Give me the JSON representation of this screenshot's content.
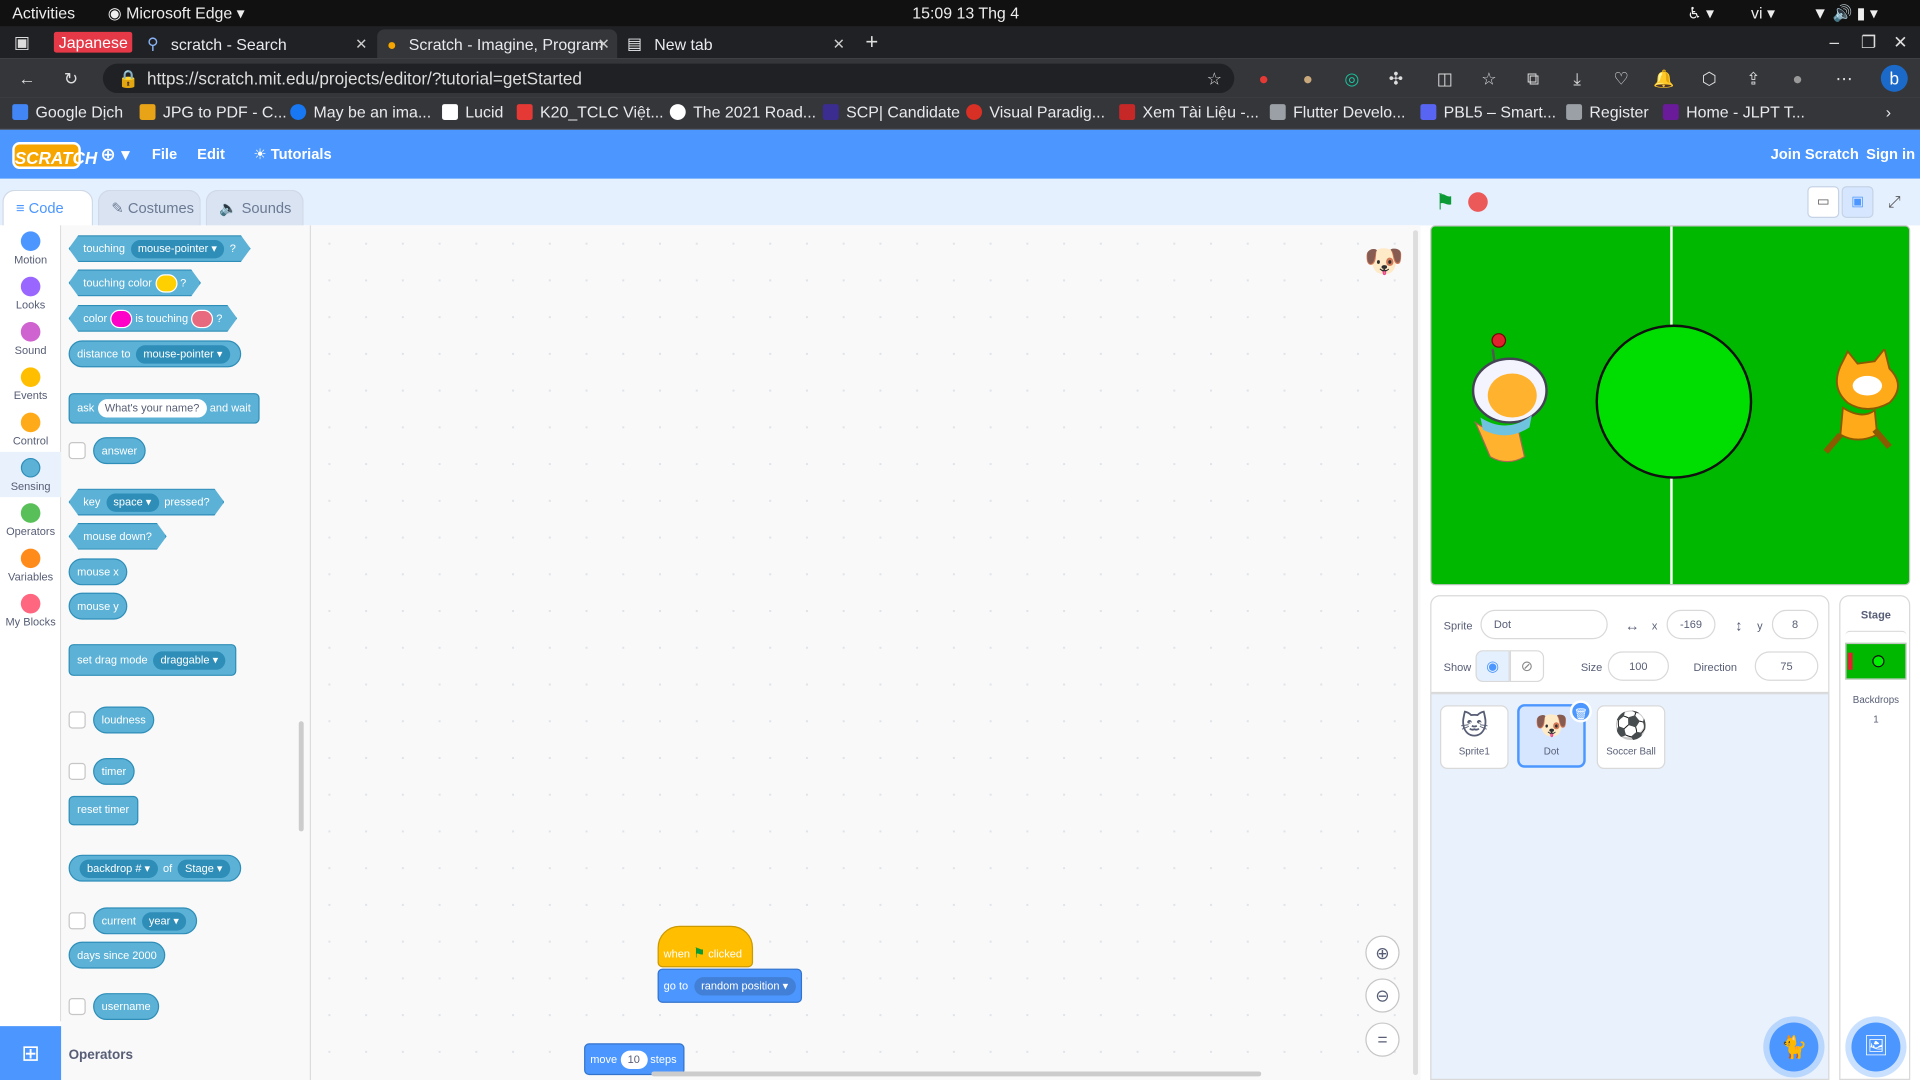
{
  "os": {
    "activities": "Activities",
    "app": "Microsoft Edge",
    "clock": "15:09  13 Thg 4",
    "lang": "vi"
  },
  "browser": {
    "ime_label": "Japanese",
    "tabs": [
      {
        "title": "scratch - Search"
      },
      {
        "title": "Scratch - Imagine, Program"
      },
      {
        "title": "New tab"
      }
    ],
    "url": "https://scratch.mit.edu/projects/editor/?tutorial=getStarted",
    "bookmarks": [
      {
        "label": "Google Dịch",
        "color": "#4285f4"
      },
      {
        "label": "JPG to PDF - C...",
        "color": "#e8a317"
      },
      {
        "label": "May be an ima...",
        "color": "#1877f2"
      },
      {
        "label": "Lucid",
        "color": "#ffffff"
      },
      {
        "label": "K20_TCLC Việt...",
        "color": "#e53935"
      },
      {
        "label": "The 2021 Road...",
        "color": "#ffffff"
      },
      {
        "label": "SCP| Candidate",
        "color": "#3b2c8f"
      },
      {
        "label": "Visual Paradig...",
        "color": "#d93025"
      },
      {
        "label": "Xem Tài Liệu -...",
        "color": "#c62828"
      },
      {
        "label": "Flutter Develo...",
        "color": "#9aa0a6"
      },
      {
        "label": "PBL5 – Smart...",
        "color": "#5865f2"
      },
      {
        "label": "Register",
        "color": "#9aa0a6"
      },
      {
        "label": "Home - JLPT T...",
        "color": "#6a1b9a"
      }
    ]
  },
  "scratch": {
    "menu": {
      "logo": "SCRATCH",
      "file": "File",
      "edit": "Edit",
      "tutorials": "Tutorials",
      "join": "Join Scratch",
      "signin": "Sign in"
    },
    "editor_tabs": {
      "code": "Code",
      "costumes": "Costumes",
      "sounds": "Sounds"
    },
    "categories": [
      {
        "label": "Motion",
        "color": "#4c97ff"
      },
      {
        "label": "Looks",
        "color": "#9966ff"
      },
      {
        "label": "Sound",
        "color": "#cf63cf"
      },
      {
        "label": "Events",
        "color": "#ffbf00"
      },
      {
        "label": "Control",
        "color": "#ffab19"
      },
      {
        "label": "Sensing",
        "color": "#5cb1d6"
      },
      {
        "label": "Operators",
        "color": "#59c059"
      },
      {
        "label": "Variables",
        "color": "#ff8c1a"
      },
      {
        "label": "My Blocks",
        "color": "#ff6680"
      }
    ],
    "palette": {
      "touching": "touching",
      "mouse_pointer": "mouse-pointer",
      "q": "?",
      "touching_color": "touching color",
      "color": "color",
      "is_touching": "is touching",
      "distance_to": "distance to",
      "ask": "ask",
      "ask_default": "What's your name?",
      "and_wait": "and wait",
      "answer": "answer",
      "key": "key",
      "space": "space",
      "pressed": "pressed?",
      "mouse_down": "mouse down?",
      "mouse_x": "mouse x",
      "mouse_y": "mouse y",
      "set_drag_mode": "set drag mode",
      "draggable": "draggable",
      "loudness": "loudness",
      "timer": "timer",
      "reset_timer": "reset timer",
      "backdrop_num": "backdrop #",
      "of": "of",
      "stage": "Stage",
      "current": "current",
      "year": "year",
      "days_since": "days since 2000",
      "username": "username",
      "operators_heading": "Operators"
    },
    "script": {
      "when": "when",
      "clicked": "clicked",
      "go_to": "go to",
      "random_position": "random position",
      "move": "move",
      "steps_value": "10",
      "steps": "steps"
    },
    "sprite_info": {
      "sprite_label": "Sprite",
      "sprite_name": "Dot",
      "x_label": "x",
      "x_value": "-169",
      "y_label": "y",
      "y_value": "8",
      "show_label": "Show",
      "size_label": "Size",
      "size_value": "100",
      "direction_label": "Direction",
      "direction_value": "75"
    },
    "sprites": [
      {
        "name": "Sprite1"
      },
      {
        "name": "Dot"
      },
      {
        "name": "Soccer Ball"
      }
    ],
    "stage_panel": {
      "title": "Stage",
      "backdrops_label": "Backdrops",
      "backdrops_count": "1"
    }
  }
}
